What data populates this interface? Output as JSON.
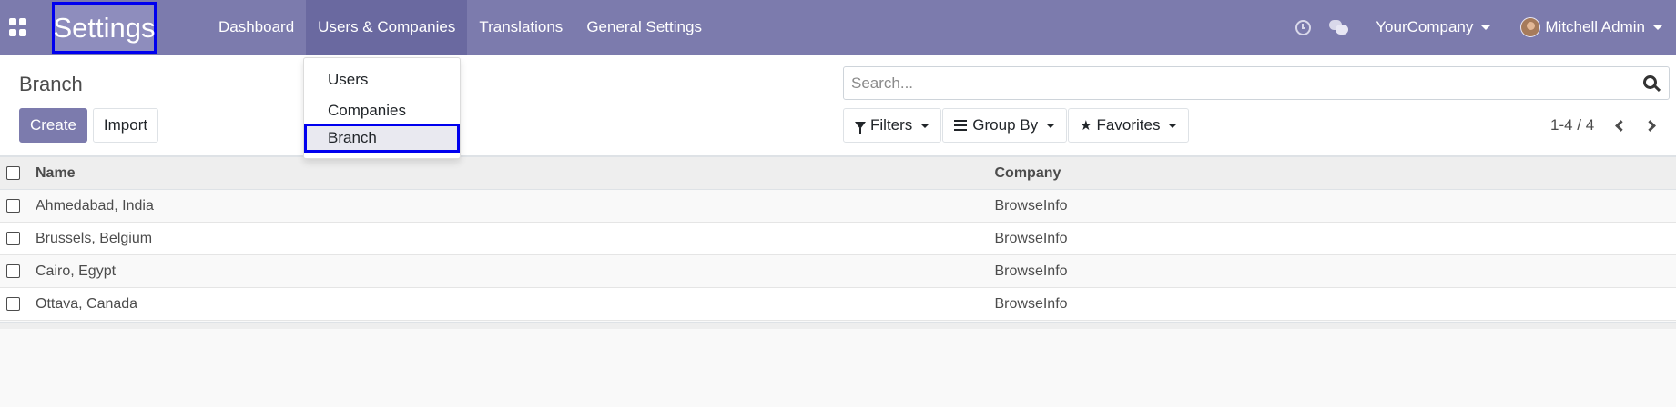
{
  "navbar": {
    "app_title": "Settings",
    "menus": [
      "Dashboard",
      "Users & Companies",
      "Translations",
      "General Settings"
    ],
    "active_menu": "Users & Companies",
    "company": "YourCompany",
    "user": "Mitchell Admin",
    "icons": [
      "apps-icon",
      "clock-icon",
      "chat-icon"
    ]
  },
  "dropdown": {
    "items": [
      "Users",
      "Companies",
      "Branch"
    ],
    "highlighted": "Branch"
  },
  "control_panel": {
    "breadcrumb": "Branch",
    "create_label": "Create",
    "import_label": "Import",
    "search_placeholder": "Search...",
    "filters_label": "Filters",
    "groupby_label": "Group By",
    "favorites_label": "Favorites",
    "pager": "1-4 / 4"
  },
  "table": {
    "headers": [
      "Name",
      "Company"
    ],
    "rows": [
      {
        "name": "Ahmedabad, India",
        "company": "BrowseInfo"
      },
      {
        "name": "Brussels, Belgium",
        "company": "BrowseInfo"
      },
      {
        "name": "Cairo, Egypt",
        "company": "BrowseInfo"
      },
      {
        "name": "Ottava, Canada",
        "company": "BrowseInfo"
      }
    ]
  },
  "colors": {
    "navbar": "#7c7bad",
    "active_menu": "#6a69a0",
    "highlight_border": "#0000ee",
    "primary_button": "#7c7bad"
  }
}
